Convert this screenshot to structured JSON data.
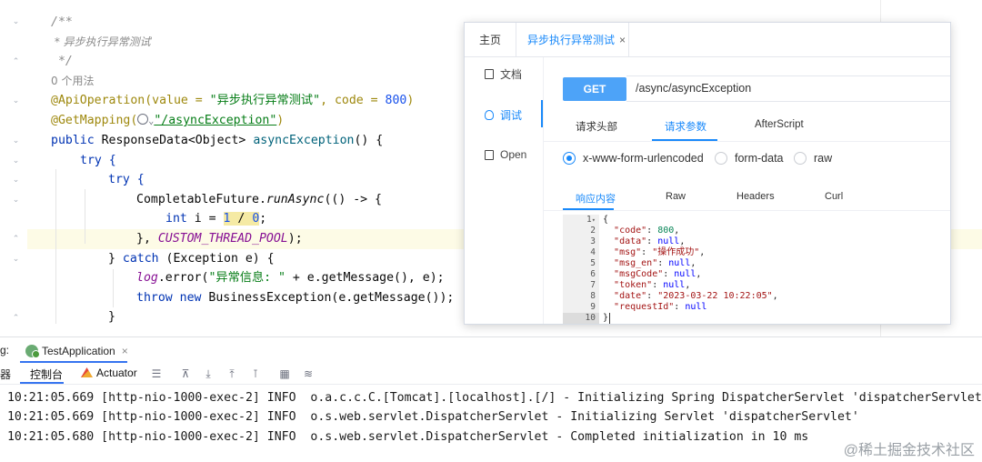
{
  "editor": {
    "comment_open": "/**",
    "comment_text": " * 异步执行异常测试",
    "comment_close": " */",
    "usage_hint": "0 个用法",
    "api_operation": {
      "prefix": "@ApiOperation(value = ",
      "value": "\"异步执行异常测试\"",
      "mid": ", code = ",
      "code": "800",
      "suffix": ")"
    },
    "get_mapping": {
      "prefix": "@GetMapping(",
      "path": "\"/asyncException\"",
      "suffix": ")"
    },
    "method_sig": {
      "kw": "public",
      "type": " ResponseData<Object> ",
      "name": "asyncException",
      "rest": "() {"
    },
    "try_outer": "try {",
    "try_inner": "try {",
    "completable": {
      "cls": "CompletableFuture.",
      "method": "runAsync",
      "rest": "(() -> {"
    },
    "int_line": {
      "kw": "int",
      "mid": " i = ",
      "n1": "1",
      "op": " / ",
      "n2": "0",
      "end": ";"
    },
    "close_lambda": {
      "start": "}, ",
      "const": "CUSTOM_THREAD_POOL",
      "end": ");"
    },
    "catch_line": {
      "start": "} ",
      "kw": "catch",
      "rest": " (Exception e) {"
    },
    "log_line": {
      "field": "log",
      "dot": ".",
      "method": "error",
      "open": "(",
      "str": "\"异常信息: \"",
      "rest": " + e.getMessage(), e);"
    },
    "throw_line": {
      "kw1": "throw",
      "sp": " ",
      "kw2": "new",
      "rest": " BusinessException(e.getMessage());"
    },
    "close_brace": "}"
  },
  "run_panel": {
    "label": "g:",
    "tab_label": "TestApplication",
    "tab_close": "×",
    "toolbar_clip": "器",
    "console_tab": "控制台",
    "actuator_tab": "Actuator",
    "log_lines": [
      " 10:21:05.669 [http-nio-1000-exec-2] INFO  o.a.c.c.C.[Tomcat].[localhost].[/] - Initializing Spring DispatcherServlet 'dispatcherServlet'",
      " 10:21:05.669 [http-nio-1000-exec-2] INFO  o.s.web.servlet.DispatcherServlet - Initializing Servlet 'dispatcherServlet'",
      " 10:21:05.680 [http-nio-1000-exec-2] INFO  o.s.web.servlet.DispatcherServlet - Completed initialization in 10 ms"
    ],
    "watermark": "@稀土掘金技术社区"
  },
  "api_window": {
    "tabs": [
      "主页",
      "异步执行异常测试"
    ],
    "tab_close": "×",
    "sidebar": [
      "文档",
      "调试",
      "Open"
    ],
    "method": "GET",
    "url": "/async/asyncException",
    "request_tabs": [
      "请求头部",
      "请求参数",
      "AfterScript"
    ],
    "body_types": [
      "x-www-form-urlencoded",
      "form-data",
      "raw"
    ],
    "response_tabs": [
      "响应内容",
      "Raw",
      "Headers",
      "Curl"
    ],
    "json_line_numbers": [
      "1",
      "2",
      "3",
      "4",
      "5",
      "6",
      "7",
      "8",
      "9",
      "10"
    ],
    "json_open": "{",
    "json_close": "}",
    "json": [
      {
        "key": "\"code\"",
        "value": "800",
        "type": "num",
        "comma": ","
      },
      {
        "key": "\"data\"",
        "value": "null",
        "type": "null",
        "comma": ","
      },
      {
        "key": "\"msg\"",
        "value": "\"操作成功\"",
        "type": "str",
        "comma": ","
      },
      {
        "key": "\"msg_en\"",
        "value": "null",
        "type": "null",
        "comma": ","
      },
      {
        "key": "\"msgCode\"",
        "value": "null",
        "type": "null",
        "comma": ","
      },
      {
        "key": "\"token\"",
        "value": "null",
        "type": "null",
        "comma": ","
      },
      {
        "key": "\"date\"",
        "value": "\"2023-03-22 10:22:05\"",
        "type": "str",
        "comma": ","
      },
      {
        "key": "\"requestId\"",
        "value": "null",
        "type": "null",
        "comma": ""
      }
    ]
  }
}
